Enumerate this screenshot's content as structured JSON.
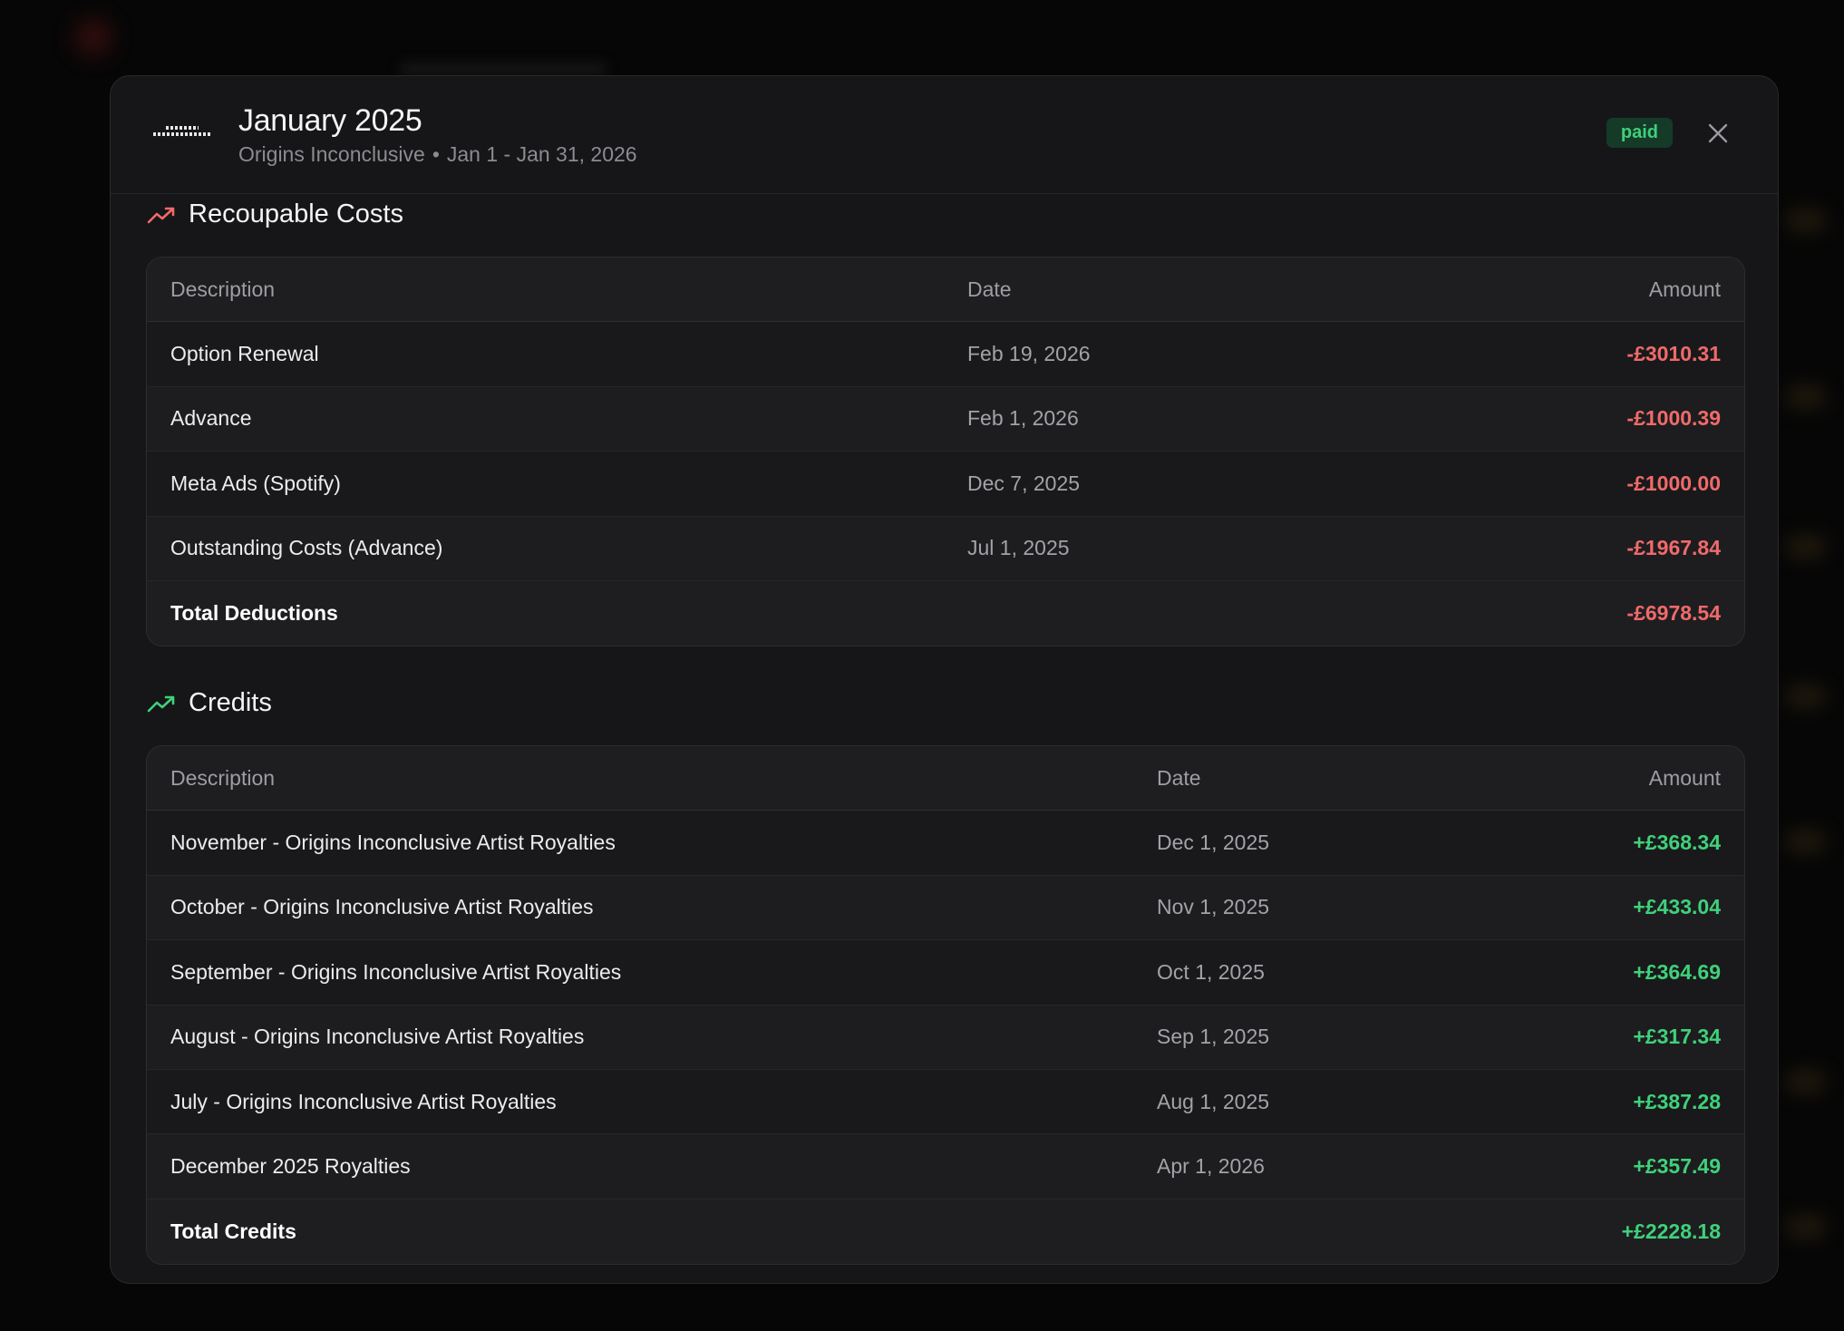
{
  "header": {
    "logo_text": "ORIGINS INCONCLUSIVE",
    "title": "January 2025",
    "artist": "Origins Inconclusive",
    "separator": "•",
    "period": "Jan 1 - Jan 31, 2026",
    "status_badge": "paid",
    "close_icon": "close-icon"
  },
  "recoupable": {
    "title": "Recoupable Costs",
    "icon": "trending-up-icon",
    "icon_color": "#f06a6a",
    "columns": [
      "Description",
      "Date",
      "Amount"
    ],
    "rows": [
      {
        "description": "Option Renewal",
        "date": "Feb 19, 2026",
        "amount": "-£3010.31"
      },
      {
        "description": "Advance",
        "date": "Feb 1, 2026",
        "amount": "-£1000.39"
      },
      {
        "description": "Meta Ads (Spotify)",
        "date": "Dec 7, 2025",
        "amount": "-£1000.00"
      },
      {
        "description": "Outstanding Costs (Advance)",
        "date": "Jul 1, 2025",
        "amount": "-£1967.84"
      }
    ],
    "total_label": "Total Deductions",
    "total_amount": "-£6978.54"
  },
  "credits": {
    "title": "Credits",
    "icon": "trending-up-icon",
    "icon_color": "#3fd17a",
    "columns": [
      "Description",
      "Date",
      "Amount"
    ],
    "rows": [
      {
        "description": "November - Origins Inconclusive Artist Royalties",
        "date": "Dec 1, 2025",
        "amount": "+£368.34"
      },
      {
        "description": "October - Origins Inconclusive Artist Royalties",
        "date": "Nov 1, 2025",
        "amount": "+£433.04"
      },
      {
        "description": "September - Origins Inconclusive Artist Royalties",
        "date": "Oct 1, 2025",
        "amount": "+£364.69"
      },
      {
        "description": "August - Origins Inconclusive Artist Royalties",
        "date": "Sep 1, 2025",
        "amount": "+£317.34"
      },
      {
        "description": "July - Origins Inconclusive Artist Royalties",
        "date": "Aug 1, 2025",
        "amount": "+£387.28"
      },
      {
        "description": "December 2025 Royalties",
        "date": "Apr 1, 2026",
        "amount": "+£357.49"
      }
    ],
    "total_label": "Total Credits",
    "total_amount": "+£2228.18"
  },
  "colors": {
    "negative": "#f06a6a",
    "positive": "#3fd17a",
    "badge_bg": "#153a28",
    "badge_text": "#3ecf7a"
  }
}
